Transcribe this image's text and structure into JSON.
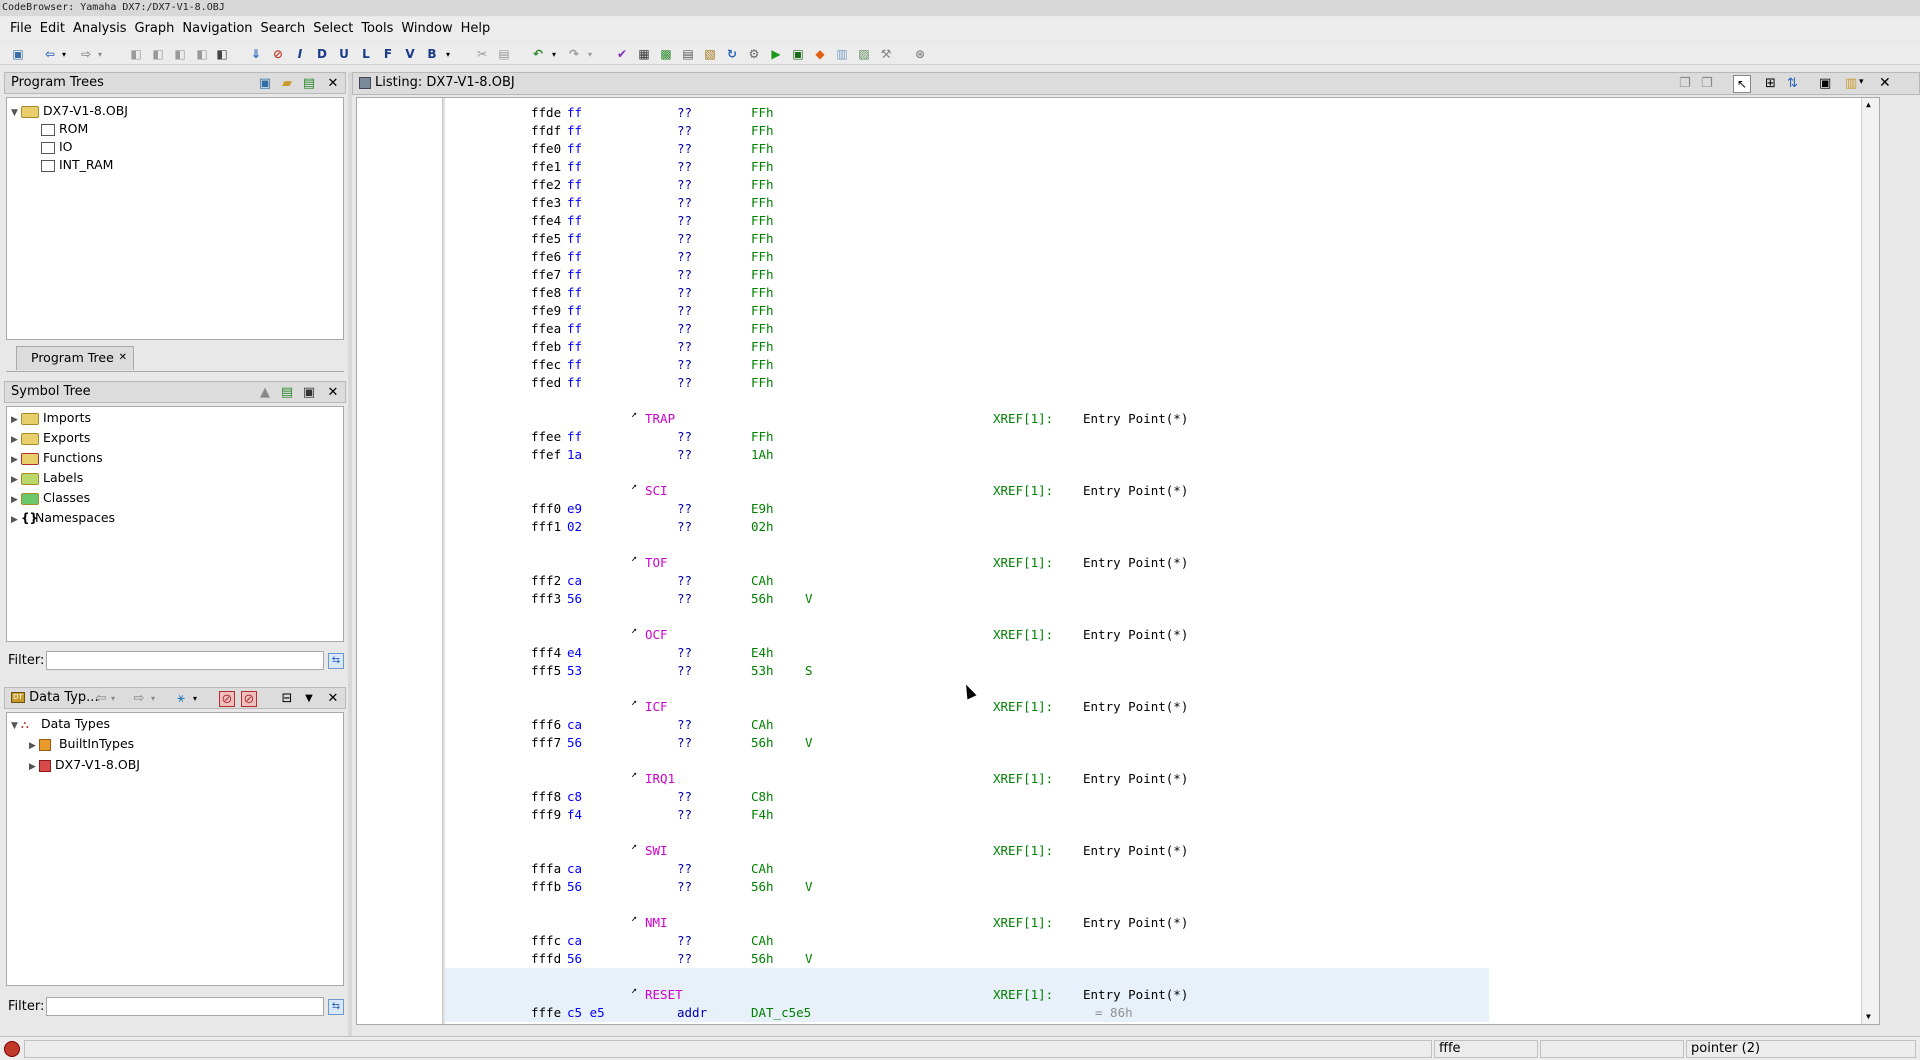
{
  "window": {
    "title": "CodeBrowser: Yamaha DX7:/DX7-V1-8.OBJ"
  },
  "menu": [
    "File",
    "Edit",
    "Analysis",
    "Graph",
    "Navigation",
    "Search",
    "Select",
    "Tools",
    "Window",
    "Help"
  ],
  "program_trees": {
    "title": "Program Trees",
    "root": "DX7-V1-8.OBJ",
    "children": [
      "ROM",
      "IO",
      "INT_RAM"
    ],
    "tab": "Program Tree"
  },
  "symbol_tree": {
    "title": "Symbol Tree",
    "items": [
      "Imports",
      "Exports",
      "Functions",
      "Labels",
      "Classes",
      "Namespaces"
    ],
    "filter_label": "Filter:"
  },
  "data_types": {
    "title": "Data Typ...",
    "root": "Data Types",
    "children": [
      "BuiltInTypes",
      "DX7-V1-8.OBJ"
    ],
    "filter_label": "Filter:"
  },
  "listing": {
    "title": "Listing:  DX7-V1-8.OBJ",
    "rows": [
      {
        "t": "data",
        "addr": "ffde",
        "bytes": "ff",
        "mn": "??",
        "op": "FFh",
        "ch": ""
      },
      {
        "t": "data",
        "addr": "ffdf",
        "bytes": "ff",
        "mn": "??",
        "op": "FFh",
        "ch": ""
      },
      {
        "t": "data",
        "addr": "ffe0",
        "bytes": "ff",
        "mn": "??",
        "op": "FFh",
        "ch": ""
      },
      {
        "t": "data",
        "addr": "ffe1",
        "bytes": "ff",
        "mn": "??",
        "op": "FFh",
        "ch": ""
      },
      {
        "t": "data",
        "addr": "ffe2",
        "bytes": "ff",
        "mn": "??",
        "op": "FFh",
        "ch": ""
      },
      {
        "t": "data",
        "addr": "ffe3",
        "bytes": "ff",
        "mn": "??",
        "op": "FFh",
        "ch": ""
      },
      {
        "t": "data",
        "addr": "ffe4",
        "bytes": "ff",
        "mn": "??",
        "op": "FFh",
        "ch": ""
      },
      {
        "t": "data",
        "addr": "ffe5",
        "bytes": "ff",
        "mn": "??",
        "op": "FFh",
        "ch": ""
      },
      {
        "t": "data",
        "addr": "ffe6",
        "bytes": "ff",
        "mn": "??",
        "op": "FFh",
        "ch": ""
      },
      {
        "t": "data",
        "addr": "ffe7",
        "bytes": "ff",
        "mn": "??",
        "op": "FFh",
        "ch": ""
      },
      {
        "t": "data",
        "addr": "ffe8",
        "bytes": "ff",
        "mn": "??",
        "op": "FFh",
        "ch": ""
      },
      {
        "t": "data",
        "addr": "ffe9",
        "bytes": "ff",
        "mn": "??",
        "op": "FFh",
        "ch": ""
      },
      {
        "t": "data",
        "addr": "ffea",
        "bytes": "ff",
        "mn": "??",
        "op": "FFh",
        "ch": ""
      },
      {
        "t": "data",
        "addr": "ffeb",
        "bytes": "ff",
        "mn": "??",
        "op": "FFh",
        "ch": ""
      },
      {
        "t": "data",
        "addr": "ffec",
        "bytes": "ff",
        "mn": "??",
        "op": "FFh",
        "ch": ""
      },
      {
        "t": "data",
        "addr": "ffed",
        "bytes": "ff",
        "mn": "??",
        "op": "FFh",
        "ch": ""
      },
      {
        "t": "blank"
      },
      {
        "t": "label",
        "name": "TRAP",
        "xref": "XREF[1]:",
        "ep": "Entry Point(*)"
      },
      {
        "t": "data",
        "addr": "ffee",
        "bytes": "ff",
        "mn": "??",
        "op": "FFh",
        "ch": ""
      },
      {
        "t": "data",
        "addr": "ffef",
        "bytes": "1a",
        "mn": "??",
        "op": "1Ah",
        "ch": ""
      },
      {
        "t": "blank"
      },
      {
        "t": "label",
        "name": "SCI",
        "xref": "XREF[1]:",
        "ep": "Entry Point(*)"
      },
      {
        "t": "data",
        "addr": "fff0",
        "bytes": "e9",
        "mn": "??",
        "op": "E9h",
        "ch": ""
      },
      {
        "t": "data",
        "addr": "fff1",
        "bytes": "02",
        "mn": "??",
        "op": "02h",
        "ch": ""
      },
      {
        "t": "blank"
      },
      {
        "t": "label",
        "name": "TOF",
        "xref": "XREF[1]:",
        "ep": "Entry Point(*)"
      },
      {
        "t": "data",
        "addr": "fff2",
        "bytes": "ca",
        "mn": "??",
        "op": "CAh",
        "ch": ""
      },
      {
        "t": "data",
        "addr": "fff3",
        "bytes": "56",
        "mn": "??",
        "op": "56h",
        "ch": "V"
      },
      {
        "t": "blank"
      },
      {
        "t": "label",
        "name": "OCF",
        "xref": "XREF[1]:",
        "ep": "Entry Point(*)"
      },
      {
        "t": "data",
        "addr": "fff4",
        "bytes": "e4",
        "mn": "??",
        "op": "E4h",
        "ch": ""
      },
      {
        "t": "data",
        "addr": "fff5",
        "bytes": "53",
        "mn": "??",
        "op": "53h",
        "ch": "S"
      },
      {
        "t": "blank"
      },
      {
        "t": "label",
        "name": "ICF",
        "xref": "XREF[1]:",
        "ep": "Entry Point(*)"
      },
      {
        "t": "data",
        "addr": "fff6",
        "bytes": "ca",
        "mn": "??",
        "op": "CAh",
        "ch": ""
      },
      {
        "t": "data",
        "addr": "fff7",
        "bytes": "56",
        "mn": "??",
        "op": "56h",
        "ch": "V"
      },
      {
        "t": "blank"
      },
      {
        "t": "label",
        "name": "IRQ1",
        "xref": "XREF[1]:",
        "ep": "Entry Point(*)"
      },
      {
        "t": "data",
        "addr": "fff8",
        "bytes": "c8",
        "mn": "??",
        "op": "C8h",
        "ch": ""
      },
      {
        "t": "data",
        "addr": "fff9",
        "bytes": "f4",
        "mn": "??",
        "op": "F4h",
        "ch": ""
      },
      {
        "t": "blank"
      },
      {
        "t": "label",
        "name": "SWI",
        "xref": "XREF[1]:",
        "ep": "Entry Point(*)"
      },
      {
        "t": "data",
        "addr": "fffa",
        "bytes": "ca",
        "mn": "??",
        "op": "CAh",
        "ch": ""
      },
      {
        "t": "data",
        "addr": "fffb",
        "bytes": "56",
        "mn": "??",
        "op": "56h",
        "ch": "V"
      },
      {
        "t": "blank"
      },
      {
        "t": "label",
        "name": "NMI",
        "xref": "XREF[1]:",
        "ep": "Entry Point(*)"
      },
      {
        "t": "data",
        "addr": "fffc",
        "bytes": "ca",
        "mn": "??",
        "op": "CAh",
        "ch": ""
      },
      {
        "t": "data",
        "addr": "fffd",
        "bytes": "56",
        "mn": "??",
        "op": "56h",
        "ch": "V"
      },
      {
        "t": "blank",
        "hl": true
      },
      {
        "t": "label",
        "name": "RESET",
        "xref": "XREF[1]:",
        "ep": "Entry Point(*)",
        "hl": true
      },
      {
        "t": "data",
        "addr": "fffe",
        "bytes": "c5 e5",
        "mn": "addr",
        "op": "DAT_c5e5",
        "ch": "",
        "cmt": "= 86h",
        "hl": true
      }
    ]
  },
  "status": {
    "address": "fffe",
    "field3": "",
    "type": "pointer (2)"
  }
}
